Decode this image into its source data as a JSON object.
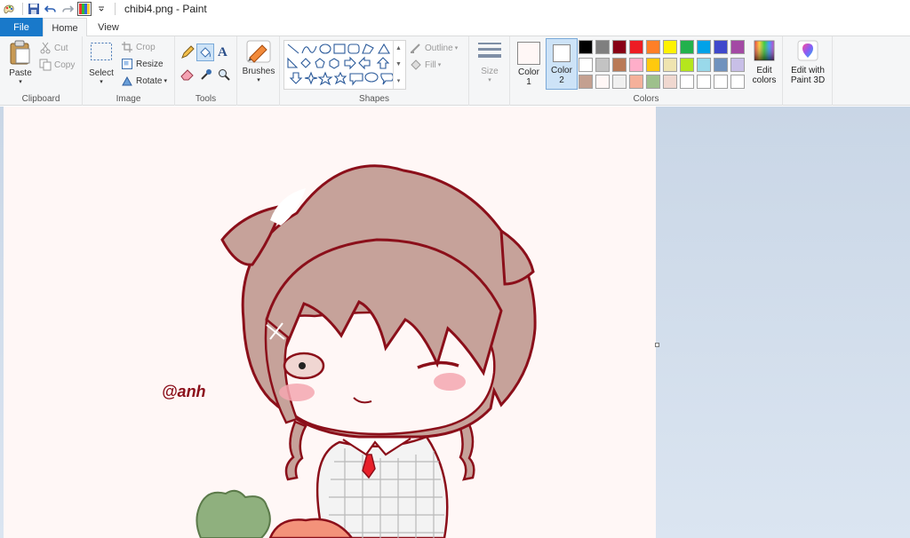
{
  "window": {
    "title": "chibi4.png - Paint"
  },
  "tabs": [
    {
      "label": "File"
    },
    {
      "label": "Home"
    },
    {
      "label": "View"
    }
  ],
  "ribbon": {
    "clipboard": {
      "group_label": "Clipboard",
      "paste": "Paste",
      "cut": "Cut",
      "copy": "Copy"
    },
    "image": {
      "group_label": "Image",
      "select": "Select",
      "crop": "Crop",
      "resize": "Resize",
      "rotate": "Rotate"
    },
    "tools": {
      "group_label": "Tools"
    },
    "brushes": {
      "label": "Brushes"
    },
    "shapes": {
      "group_label": "Shapes",
      "outline": "Outline",
      "fill": "Fill"
    },
    "size": {
      "label": "Size"
    },
    "colors": {
      "group_label": "Colors",
      "color1_label": "Color\n1",
      "color1_line1": "Color",
      "color1_line2": "1",
      "color2_line1": "Color",
      "color2_line2": "2",
      "edit_colors_line1": "Edit",
      "edit_colors_line2": "colors",
      "edit_3d_line1": "Edit with",
      "edit_3d_line2": "Paint 3D",
      "color1": "#fff7f6",
      "color2": "#ffffff",
      "palette_row1": [
        "#000000",
        "#7f7f7f",
        "#880015",
        "#ed1c24",
        "#ff7f27",
        "#fff200",
        "#22b14c",
        "#00a2e8",
        "#3f48cc",
        "#a349a4"
      ],
      "palette_row2": [
        "#ffffff",
        "#c3c3c3",
        "#b97a57",
        "#ffaec9",
        "#ffc90e",
        "#efe4b0",
        "#b5e61d",
        "#99d9ea",
        "#7092be",
        "#c8bfe7"
      ],
      "palette_row3": [
        "#c4a090",
        "#fff7f6",
        "#f0f0f0",
        "#f5b09a",
        "#9ec08c",
        "#f0d8d0",
        "#ffffff",
        "#ffffff",
        "#ffffff",
        "#ffffff"
      ]
    }
  },
  "canvas": {
    "watermark_text": "@anh",
    "hair_color": "#c6a29a",
    "outline_color": "#8b0f1a",
    "leaf_color": "#8fb07e",
    "tie_color": "#e8202a"
  }
}
